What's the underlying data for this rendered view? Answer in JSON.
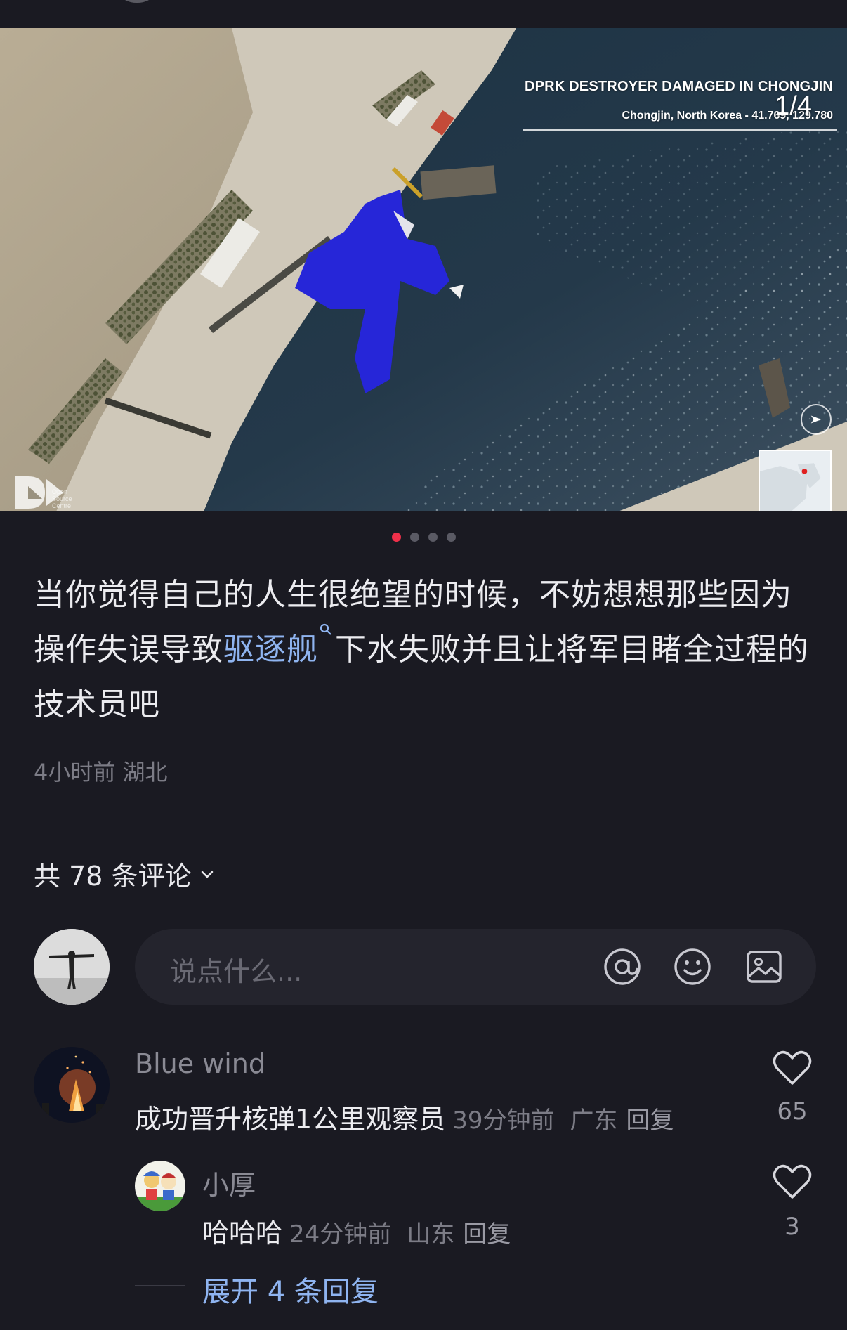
{
  "image": {
    "title": "DPRK DESTROYER DAMAGED IN CHONGJIN",
    "subtitle": "Chongjin, North Korea - 41.769, 129.780",
    "counter": "1/4",
    "watermark_lines": [
      "Open",
      "Source",
      "Centre"
    ],
    "total_pages": 4,
    "active_page": 1
  },
  "post": {
    "text_before": "当你觉得自己的人生很绝望的时候，不妨想想那些因为操作失误导致",
    "tag": "驱逐舰",
    "text_after": "下水失败并且让将军目睹全过程的技术员吧",
    "time": "4小时前",
    "location": "湖北"
  },
  "comments_header": "共 78 条评论",
  "input": {
    "placeholder": "说点什么..."
  },
  "comments": [
    {
      "name": "Blue wind",
      "text": "成功晋升核弹1公里观察员",
      "time": "39分钟前",
      "location": "广东",
      "reply": "回复",
      "likes": "65"
    },
    {
      "name": "小厚",
      "text": "哈哈哈",
      "time": "24分钟前",
      "location": "山东",
      "reply": "回复",
      "likes": "3"
    }
  ],
  "expand_replies": "展开 4 条回复",
  "colors": {
    "background": "#1a1a22",
    "accent_dot": "#f0304a",
    "link": "#8fb4f0",
    "tarp_blue": "#2626d8"
  },
  "icons": [
    "at-icon",
    "emoji-icon",
    "image-icon",
    "heart-icon",
    "chevron-down-icon",
    "search-icon",
    "compass-icon"
  ]
}
